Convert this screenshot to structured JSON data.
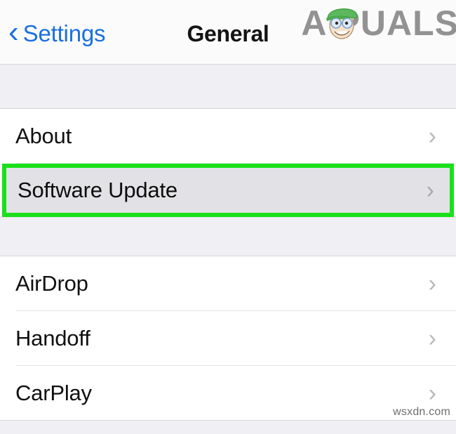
{
  "navbar": {
    "back_label": "Settings",
    "back_icon": "chevron-left-icon",
    "title": "General",
    "accent_color": "#1a6fe0"
  },
  "logo": {
    "text": "A PUALS",
    "text_before": "A",
    "text_after": "PUALS",
    "mascot_icon": "mascot-head-green-cap-icon",
    "color": "#8a8a8a",
    "cap_color": "#5cb85c"
  },
  "list": {
    "chevron_icon": "chevron-right-icon",
    "sections": [
      {
        "rows": [
          {
            "label": "About",
            "selected": false
          },
          {
            "label": "Software Update",
            "selected": true
          }
        ]
      },
      {
        "rows": [
          {
            "label": "AirDrop",
            "selected": false
          },
          {
            "label": "Handoff",
            "selected": false
          },
          {
            "label": "CarPlay",
            "selected": false
          }
        ]
      }
    ]
  },
  "highlight": {
    "color": "#19e019",
    "background": "#e2e2e6"
  },
  "footer": {
    "watermark": "wsxdn.com"
  }
}
